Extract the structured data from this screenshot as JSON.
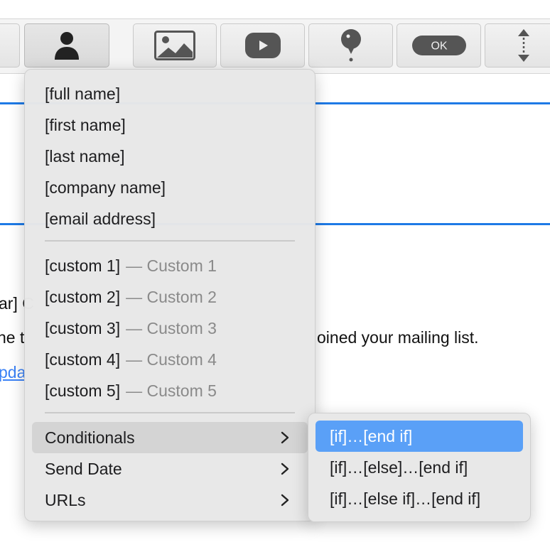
{
  "toolbar": {
    "buttons": [
      {
        "name": "person-icon",
        "active": true
      },
      {
        "name": "image-icon"
      },
      {
        "name": "video-play-icon"
      },
      {
        "name": "map-pin-icon"
      },
      {
        "name": "ok-button-icon",
        "label": "OK"
      },
      {
        "name": "vertical-spacer-icon"
      }
    ]
  },
  "background": {
    "fragment_left_1": "ar] C",
    "fragment_left_2": "ne t",
    "fragment_right": "oined your mailing list.",
    "link_fragment": "pda"
  },
  "menu": {
    "fields": [
      "[full name]",
      "[first name]",
      "[last name]",
      "[company name]",
      "[email address]"
    ],
    "custom": [
      {
        "tag": "[custom 1]",
        "note": "— Custom 1"
      },
      {
        "tag": "[custom 2]",
        "note": "— Custom 2"
      },
      {
        "tag": "[custom 3]",
        "note": "— Custom 3"
      },
      {
        "tag": "[custom 4]",
        "note": "— Custom 4"
      },
      {
        "tag": "[custom 5]",
        "note": "— Custom 5"
      }
    ],
    "submenus": [
      "Conditionals",
      "Send Date",
      "URLs"
    ]
  },
  "submenu": {
    "items": [
      "[if]…[end if]",
      "[if]…[else]…[end if]",
      "[if]…[else if]…[end if]"
    ]
  },
  "colors": {
    "accent_blue": "#1e7ae6",
    "selection_blue": "#5aa0f7",
    "link_blue": "#3b82f6"
  }
}
